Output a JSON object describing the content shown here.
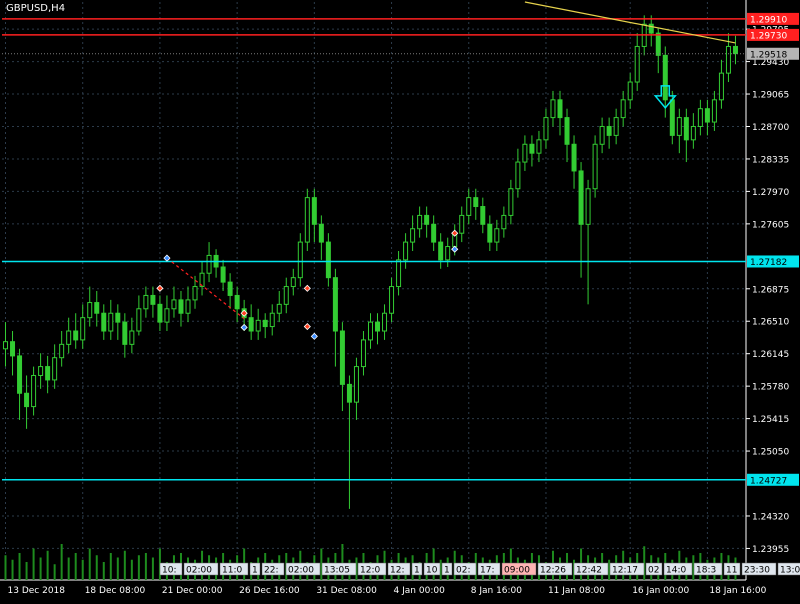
{
  "symbol_label": "GBPUSD,H4",
  "colors": {
    "background": "#000000",
    "grid": "#2c3b4a",
    "candle": "#33cc33",
    "volume": "#1e8c1e",
    "resistance": "#ff2020",
    "support": "#00e5ee",
    "trend": "#e6d24c",
    "arrow": "#00e5ee",
    "price_tag": "#b4b4b4"
  },
  "icons": {
    "down_arrow": "down-arrow-icon",
    "buy_marker": "buy-marker-icon",
    "sell_marker": "sell-marker-icon"
  },
  "chart_data": {
    "type": "candlestick",
    "ylim": [
      1.236,
      1.301
    ],
    "y_ticks": [
      "1.29795",
      "1.29430",
      "1.29065",
      "1.28700",
      "1.28335",
      "1.27970",
      "1.27605",
      "1.26875",
      "1.26510",
      "1.26145",
      "1.25780",
      "1.25415",
      "1.25050",
      "1.24320",
      "1.23955"
    ],
    "x_ticks": [
      "13 Dec 2018",
      "18 Dec 08:00",
      "21 Dec 00:00",
      "26 Dec 16:00",
      "31 Dec 08:00",
      "4 Jan 00:00",
      "8 Jan 16:00",
      "11 Jan 08:00",
      "16 Jan 00:00",
      "18 Jan 16:00"
    ],
    "horizontal_lines": [
      {
        "label": "1.29910",
        "value": 1.2991,
        "kind": "resistance"
      },
      {
        "label": "1.29730",
        "value": 1.2973,
        "kind": "resistance"
      },
      {
        "label": "1.27182",
        "value": 1.27182,
        "kind": "support"
      },
      {
        "label": "1.24727",
        "value": 1.24727,
        "kind": "support"
      }
    ],
    "current_price": "1.29518",
    "time_tags": [
      "10:",
      "02:00",
      "11:0",
      "1",
      "22:",
      "02:00",
      "13:05",
      "12:0",
      "12:",
      "1",
      "10",
      "1",
      "02:",
      "17:",
      "09:00",
      "12:26",
      "12:42",
      "12:17",
      "02",
      "14:0",
      "18:3",
      "11",
      "23:30",
      "13:00"
    ],
    "candles": [
      [
        1.262,
        1.2628,
        1.265,
        1.26
      ],
      [
        1.2628,
        1.2612,
        1.264,
        1.259
      ],
      [
        1.2612,
        1.257,
        1.262,
        1.254
      ],
      [
        1.257,
        1.2555,
        1.259,
        1.253
      ],
      [
        1.2555,
        1.259,
        1.26,
        1.2545
      ],
      [
        1.259,
        1.26,
        1.2615,
        1.2575
      ],
      [
        1.26,
        1.2585,
        1.2612,
        1.257
      ],
      [
        1.2585,
        1.261,
        1.2625,
        1.2575
      ],
      [
        1.261,
        1.2625,
        1.264,
        1.26
      ],
      [
        1.2625,
        1.264,
        1.2655,
        1.2615
      ],
      [
        1.264,
        1.263,
        1.266,
        1.262
      ],
      [
        1.263,
        1.2655,
        1.267,
        1.262
      ],
      [
        1.2655,
        1.2672,
        1.269,
        1.2645
      ],
      [
        1.2672,
        1.266,
        1.2685,
        1.2645
      ],
      [
        1.266,
        1.264,
        1.267,
        1.263
      ],
      [
        1.264,
        1.266,
        1.2675,
        1.263
      ],
      [
        1.266,
        1.265,
        1.267,
        1.263
      ],
      [
        1.265,
        1.2625,
        1.266,
        1.261
      ],
      [
        1.2625,
        1.264,
        1.2655,
        1.2615
      ],
      [
        1.264,
        1.2665,
        1.268,
        1.2635
      ],
      [
        1.2665,
        1.268,
        1.269,
        1.2655
      ],
      [
        1.268,
        1.267,
        1.269,
        1.2655
      ],
      [
        1.267,
        1.265,
        1.268,
        1.264
      ],
      [
        1.265,
        1.2665,
        1.268,
        1.264
      ],
      [
        1.2665,
        1.2675,
        1.269,
        1.2655
      ],
      [
        1.2675,
        1.266,
        1.2685,
        1.2645
      ],
      [
        1.266,
        1.2675,
        1.269,
        1.265
      ],
      [
        1.2675,
        1.269,
        1.2702,
        1.2665
      ],
      [
        1.269,
        1.2705,
        1.2718,
        1.268
      ],
      [
        1.2705,
        1.2725,
        1.274,
        1.2695
      ],
      [
        1.2725,
        1.2712,
        1.2732,
        1.27
      ],
      [
        1.2712,
        1.2695,
        1.272,
        1.2685
      ],
      [
        1.2695,
        1.268,
        1.2705,
        1.2665
      ],
      [
        1.268,
        1.2665,
        1.269,
        1.265
      ],
      [
        1.2665,
        1.2655,
        1.2675,
        1.264
      ],
      [
        1.2655,
        1.264,
        1.267,
        1.263
      ],
      [
        1.264,
        1.2652,
        1.2665,
        1.263
      ],
      [
        1.2652,
        1.2645,
        1.266,
        1.2632
      ],
      [
        1.2645,
        1.266,
        1.267,
        1.2635
      ],
      [
        1.266,
        1.267,
        1.2685,
        1.265
      ],
      [
        1.267,
        1.269,
        1.27,
        1.266
      ],
      [
        1.269,
        1.27,
        1.271,
        1.268
      ],
      [
        1.27,
        1.274,
        1.275,
        1.269
      ],
      [
        1.274,
        1.279,
        1.28,
        1.273
      ],
      [
        1.279,
        1.276,
        1.28,
        1.274
      ],
      [
        1.276,
        1.274,
        1.277,
        1.272
      ],
      [
        1.274,
        1.27,
        1.275,
        1.269
      ],
      [
        1.27,
        1.264,
        1.271,
        1.26
      ],
      [
        1.264,
        1.258,
        1.265,
        1.255
      ],
      [
        1.258,
        1.256,
        1.259,
        1.244
      ],
      [
        1.256,
        1.26,
        1.261,
        1.254
      ],
      [
        1.26,
        1.263,
        1.264,
        1.259
      ],
      [
        1.263,
        1.265,
        1.266,
        1.262
      ],
      [
        1.265,
        1.264,
        1.266,
        1.2625
      ],
      [
        1.264,
        1.266,
        1.267,
        1.263
      ],
      [
        1.266,
        1.269,
        1.27,
        1.265
      ],
      [
        1.269,
        1.272,
        1.273,
        1.268
      ],
      [
        1.272,
        1.274,
        1.275,
        1.271
      ],
      [
        1.274,
        1.2755,
        1.277,
        1.273
      ],
      [
        1.2755,
        1.277,
        1.278,
        1.2745
      ],
      [
        1.277,
        1.276,
        1.278,
        1.2745
      ],
      [
        1.276,
        1.274,
        1.277,
        1.273
      ],
      [
        1.274,
        1.272,
        1.275,
        1.271
      ],
      [
        1.272,
        1.2735,
        1.2745,
        1.2712
      ],
      [
        1.2735,
        1.275,
        1.276,
        1.2725
      ],
      [
        1.275,
        1.277,
        1.278,
        1.274
      ],
      [
        1.277,
        1.279,
        1.28,
        1.276
      ],
      [
        1.279,
        1.278,
        1.28,
        1.2765
      ],
      [
        1.278,
        1.276,
        1.279,
        1.275
      ],
      [
        1.276,
        1.274,
        1.277,
        1.273
      ],
      [
        1.274,
        1.2755,
        1.2765,
        1.273
      ],
      [
        1.2755,
        1.277,
        1.278,
        1.2745
      ],
      [
        1.277,
        1.28,
        1.281,
        1.276
      ],
      [
        1.28,
        1.283,
        1.2845,
        1.279
      ],
      [
        1.283,
        1.285,
        1.286,
        1.282
      ],
      [
        1.285,
        1.284,
        1.286,
        1.2825
      ],
      [
        1.284,
        1.2855,
        1.2865,
        1.283
      ],
      [
        1.2855,
        1.288,
        1.289,
        1.2845
      ],
      [
        1.288,
        1.29,
        1.291,
        1.287
      ],
      [
        1.29,
        1.288,
        1.291,
        1.286
      ],
      [
        1.288,
        1.285,
        1.289,
        1.283
      ],
      [
        1.285,
        1.282,
        1.286,
        1.28
      ],
      [
        1.282,
        1.276,
        1.283,
        1.27
      ],
      [
        1.276,
        1.28,
        1.281,
        1.267
      ],
      [
        1.28,
        1.285,
        1.286,
        1.279
      ],
      [
        1.285,
        1.287,
        1.288,
        1.284
      ],
      [
        1.287,
        1.286,
        1.288,
        1.2845
      ],
      [
        1.286,
        1.288,
        1.289,
        1.285
      ],
      [
        1.288,
        1.29,
        1.291,
        1.287
      ],
      [
        1.29,
        1.292,
        1.293,
        1.289
      ],
      [
        1.292,
        1.296,
        1.2975,
        1.291
      ],
      [
        1.296,
        1.2985,
        1.2995,
        1.295
      ],
      [
        1.2985,
        1.2975,
        1.2995,
        1.296
      ],
      [
        1.2975,
        1.295,
        1.298,
        1.293
      ],
      [
        1.295,
        1.29,
        1.296,
        1.288
      ],
      [
        1.29,
        1.286,
        1.291,
        1.285
      ],
      [
        1.286,
        1.288,
        1.289,
        1.284
      ],
      [
        1.288,
        1.2855,
        1.289,
        1.283
      ],
      [
        1.2855,
        1.287,
        1.2885,
        1.2845
      ],
      [
        1.287,
        1.289,
        1.29,
        1.286
      ],
      [
        1.289,
        1.2875,
        1.29,
        1.286
      ],
      [
        1.2875,
        1.29,
        1.291,
        1.2865
      ],
      [
        1.29,
        1.293,
        1.2945,
        1.289
      ],
      [
        1.293,
        1.296,
        1.2975,
        1.292
      ],
      [
        1.296,
        1.2952,
        1.2972,
        1.294
      ]
    ],
    "volumes": [
      0.55,
      0.45,
      0.6,
      0.4,
      0.7,
      0.5,
      0.65,
      0.35,
      0.8,
      0.5,
      0.6,
      0.45,
      0.7,
      0.55,
      0.4,
      0.6,
      0.5,
      0.65,
      0.45,
      0.55,
      0.6,
      0.5,
      0.7,
      0.4,
      0.55,
      0.6,
      0.5,
      0.45,
      0.65,
      0.55,
      0.5,
      0.6,
      0.45,
      0.55,
      0.7,
      0.4,
      0.5,
      0.6,
      0.45,
      0.55,
      0.6,
      0.5,
      0.65,
      0.4,
      0.55,
      0.7,
      0.5,
      0.6,
      0.8,
      0.45,
      0.5,
      0.6,
      0.4,
      0.55,
      0.65,
      0.45,
      0.6,
      0.5,
      0.55,
      0.4,
      0.6,
      0.7,
      0.45,
      0.5,
      0.65,
      0.55,
      0.4,
      0.6,
      0.5,
      0.45,
      0.55,
      0.6,
      0.7,
      0.5,
      0.45,
      0.6,
      0.55,
      0.4,
      0.65,
      0.5,
      0.6,
      0.45,
      0.7,
      0.55,
      0.5,
      0.6,
      0.45,
      0.55,
      0.65,
      0.5,
      0.6,
      0.75,
      0.55,
      0.5,
      0.6,
      0.45,
      0.65,
      0.5,
      0.55,
      0.6,
      0.45,
      0.5,
      0.6,
      0.55,
      0.5
    ],
    "trendline": {
      "from": [
        74,
        1.301
      ],
      "to": [
        104,
        1.2964
      ]
    },
    "markers": [
      {
        "i": 23,
        "value": 1.2722,
        "kind": "buy"
      },
      {
        "i": 22,
        "value": 1.2688,
        "kind": "sell"
      },
      {
        "i": 34,
        "value": 1.266,
        "kind": "sell"
      },
      {
        "i": 34,
        "value": 1.2644,
        "kind": "buy"
      },
      {
        "i": 43,
        "value": 1.2688,
        "kind": "sell"
      },
      {
        "i": 43,
        "value": 1.2645,
        "kind": "sell"
      },
      {
        "i": 44,
        "value": 1.2634,
        "kind": "buy"
      },
      {
        "i": 64,
        "value": 1.275,
        "kind": "sell"
      },
      {
        "i": 64,
        "value": 1.2732,
        "kind": "buy"
      }
    ],
    "arrow_signal": {
      "i": 94,
      "value": 1.29,
      "direction": "down"
    }
  }
}
